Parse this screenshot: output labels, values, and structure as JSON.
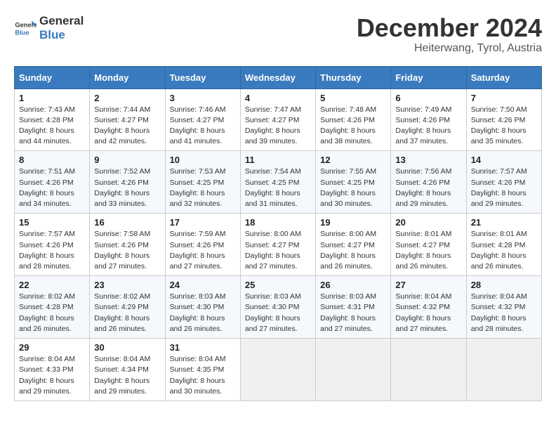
{
  "logo": {
    "line1": "General",
    "line2": "Blue"
  },
  "title": "December 2024",
  "subtitle": "Heiterwang, Tyrol, Austria",
  "days_of_week": [
    "Sunday",
    "Monday",
    "Tuesday",
    "Wednesday",
    "Thursday",
    "Friday",
    "Saturday"
  ],
  "weeks": [
    [
      {
        "day": "1",
        "sunrise": "7:43 AM",
        "sunset": "4:28 PM",
        "daylight": "8 hours and 44 minutes."
      },
      {
        "day": "2",
        "sunrise": "7:44 AM",
        "sunset": "4:27 PM",
        "daylight": "8 hours and 42 minutes."
      },
      {
        "day": "3",
        "sunrise": "7:46 AM",
        "sunset": "4:27 PM",
        "daylight": "8 hours and 41 minutes."
      },
      {
        "day": "4",
        "sunrise": "7:47 AM",
        "sunset": "4:27 PM",
        "daylight": "8 hours and 39 minutes."
      },
      {
        "day": "5",
        "sunrise": "7:48 AM",
        "sunset": "4:26 PM",
        "daylight": "8 hours and 38 minutes."
      },
      {
        "day": "6",
        "sunrise": "7:49 AM",
        "sunset": "4:26 PM",
        "daylight": "8 hours and 37 minutes."
      },
      {
        "day": "7",
        "sunrise": "7:50 AM",
        "sunset": "4:26 PM",
        "daylight": "8 hours and 35 minutes."
      }
    ],
    [
      {
        "day": "8",
        "sunrise": "7:51 AM",
        "sunset": "4:26 PM",
        "daylight": "8 hours and 34 minutes."
      },
      {
        "day": "9",
        "sunrise": "7:52 AM",
        "sunset": "4:26 PM",
        "daylight": "8 hours and 33 minutes."
      },
      {
        "day": "10",
        "sunrise": "7:53 AM",
        "sunset": "4:25 PM",
        "daylight": "8 hours and 32 minutes."
      },
      {
        "day": "11",
        "sunrise": "7:54 AM",
        "sunset": "4:25 PM",
        "daylight": "8 hours and 31 minutes."
      },
      {
        "day": "12",
        "sunrise": "7:55 AM",
        "sunset": "4:25 PM",
        "daylight": "8 hours and 30 minutes."
      },
      {
        "day": "13",
        "sunrise": "7:56 AM",
        "sunset": "4:26 PM",
        "daylight": "8 hours and 29 minutes."
      },
      {
        "day": "14",
        "sunrise": "7:57 AM",
        "sunset": "4:26 PM",
        "daylight": "8 hours and 29 minutes."
      }
    ],
    [
      {
        "day": "15",
        "sunrise": "7:57 AM",
        "sunset": "4:26 PM",
        "daylight": "8 hours and 28 minutes."
      },
      {
        "day": "16",
        "sunrise": "7:58 AM",
        "sunset": "4:26 PM",
        "daylight": "8 hours and 27 minutes."
      },
      {
        "day": "17",
        "sunrise": "7:59 AM",
        "sunset": "4:26 PM",
        "daylight": "8 hours and 27 minutes."
      },
      {
        "day": "18",
        "sunrise": "8:00 AM",
        "sunset": "4:27 PM",
        "daylight": "8 hours and 27 minutes."
      },
      {
        "day": "19",
        "sunrise": "8:00 AM",
        "sunset": "4:27 PM",
        "daylight": "8 hours and 26 minutes."
      },
      {
        "day": "20",
        "sunrise": "8:01 AM",
        "sunset": "4:27 PM",
        "daylight": "8 hours and 26 minutes."
      },
      {
        "day": "21",
        "sunrise": "8:01 AM",
        "sunset": "4:28 PM",
        "daylight": "8 hours and 26 minutes."
      }
    ],
    [
      {
        "day": "22",
        "sunrise": "8:02 AM",
        "sunset": "4:28 PM",
        "daylight": "8 hours and 26 minutes."
      },
      {
        "day": "23",
        "sunrise": "8:02 AM",
        "sunset": "4:29 PM",
        "daylight": "8 hours and 26 minutes."
      },
      {
        "day": "24",
        "sunrise": "8:03 AM",
        "sunset": "4:30 PM",
        "daylight": "8 hours and 26 minutes."
      },
      {
        "day": "25",
        "sunrise": "8:03 AM",
        "sunset": "4:30 PM",
        "daylight": "8 hours and 27 minutes."
      },
      {
        "day": "26",
        "sunrise": "8:03 AM",
        "sunset": "4:31 PM",
        "daylight": "8 hours and 27 minutes."
      },
      {
        "day": "27",
        "sunrise": "8:04 AM",
        "sunset": "4:32 PM",
        "daylight": "8 hours and 27 minutes."
      },
      {
        "day": "28",
        "sunrise": "8:04 AM",
        "sunset": "4:32 PM",
        "daylight": "8 hours and 28 minutes."
      }
    ],
    [
      {
        "day": "29",
        "sunrise": "8:04 AM",
        "sunset": "4:33 PM",
        "daylight": "8 hours and 29 minutes."
      },
      {
        "day": "30",
        "sunrise": "8:04 AM",
        "sunset": "4:34 PM",
        "daylight": "8 hours and 29 minutes."
      },
      {
        "day": "31",
        "sunrise": "8:04 AM",
        "sunset": "4:35 PM",
        "daylight": "8 hours and 30 minutes."
      },
      null,
      null,
      null,
      null
    ]
  ],
  "labels": {
    "sunrise": "Sunrise:",
    "sunset": "Sunset:",
    "daylight": "Daylight:"
  }
}
